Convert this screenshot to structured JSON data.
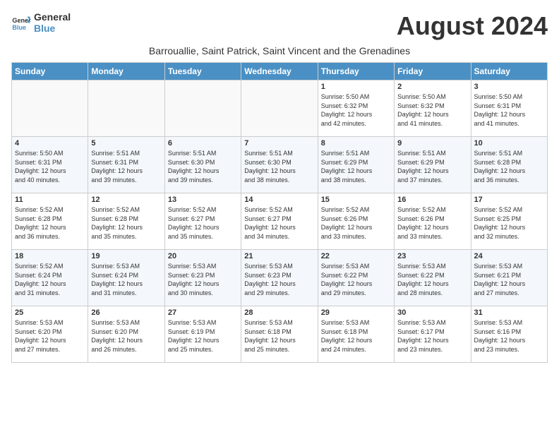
{
  "logo": {
    "line1": "General",
    "line2": "Blue"
  },
  "title": "August 2024",
  "subtitle": "Barrouallie, Saint Patrick, Saint Vincent and the Grenadines",
  "headers": [
    "Sunday",
    "Monday",
    "Tuesday",
    "Wednesday",
    "Thursday",
    "Friday",
    "Saturday"
  ],
  "weeks": [
    [
      {
        "day": "",
        "info": ""
      },
      {
        "day": "",
        "info": ""
      },
      {
        "day": "",
        "info": ""
      },
      {
        "day": "",
        "info": ""
      },
      {
        "day": "1",
        "info": "Sunrise: 5:50 AM\nSunset: 6:32 PM\nDaylight: 12 hours\nand 42 minutes."
      },
      {
        "day": "2",
        "info": "Sunrise: 5:50 AM\nSunset: 6:32 PM\nDaylight: 12 hours\nand 41 minutes."
      },
      {
        "day": "3",
        "info": "Sunrise: 5:50 AM\nSunset: 6:31 PM\nDaylight: 12 hours\nand 41 minutes."
      }
    ],
    [
      {
        "day": "4",
        "info": "Sunrise: 5:50 AM\nSunset: 6:31 PM\nDaylight: 12 hours\nand 40 minutes."
      },
      {
        "day": "5",
        "info": "Sunrise: 5:51 AM\nSunset: 6:31 PM\nDaylight: 12 hours\nand 39 minutes."
      },
      {
        "day": "6",
        "info": "Sunrise: 5:51 AM\nSunset: 6:30 PM\nDaylight: 12 hours\nand 39 minutes."
      },
      {
        "day": "7",
        "info": "Sunrise: 5:51 AM\nSunset: 6:30 PM\nDaylight: 12 hours\nand 38 minutes."
      },
      {
        "day": "8",
        "info": "Sunrise: 5:51 AM\nSunset: 6:29 PM\nDaylight: 12 hours\nand 38 minutes."
      },
      {
        "day": "9",
        "info": "Sunrise: 5:51 AM\nSunset: 6:29 PM\nDaylight: 12 hours\nand 37 minutes."
      },
      {
        "day": "10",
        "info": "Sunrise: 5:51 AM\nSunset: 6:28 PM\nDaylight: 12 hours\nand 36 minutes."
      }
    ],
    [
      {
        "day": "11",
        "info": "Sunrise: 5:52 AM\nSunset: 6:28 PM\nDaylight: 12 hours\nand 36 minutes."
      },
      {
        "day": "12",
        "info": "Sunrise: 5:52 AM\nSunset: 6:28 PM\nDaylight: 12 hours\nand 35 minutes."
      },
      {
        "day": "13",
        "info": "Sunrise: 5:52 AM\nSunset: 6:27 PM\nDaylight: 12 hours\nand 35 minutes."
      },
      {
        "day": "14",
        "info": "Sunrise: 5:52 AM\nSunset: 6:27 PM\nDaylight: 12 hours\nand 34 minutes."
      },
      {
        "day": "15",
        "info": "Sunrise: 5:52 AM\nSunset: 6:26 PM\nDaylight: 12 hours\nand 33 minutes."
      },
      {
        "day": "16",
        "info": "Sunrise: 5:52 AM\nSunset: 6:26 PM\nDaylight: 12 hours\nand 33 minutes."
      },
      {
        "day": "17",
        "info": "Sunrise: 5:52 AM\nSunset: 6:25 PM\nDaylight: 12 hours\nand 32 minutes."
      }
    ],
    [
      {
        "day": "18",
        "info": "Sunrise: 5:52 AM\nSunset: 6:24 PM\nDaylight: 12 hours\nand 31 minutes."
      },
      {
        "day": "19",
        "info": "Sunrise: 5:53 AM\nSunset: 6:24 PM\nDaylight: 12 hours\nand 31 minutes."
      },
      {
        "day": "20",
        "info": "Sunrise: 5:53 AM\nSunset: 6:23 PM\nDaylight: 12 hours\nand 30 minutes."
      },
      {
        "day": "21",
        "info": "Sunrise: 5:53 AM\nSunset: 6:23 PM\nDaylight: 12 hours\nand 29 minutes."
      },
      {
        "day": "22",
        "info": "Sunrise: 5:53 AM\nSunset: 6:22 PM\nDaylight: 12 hours\nand 29 minutes."
      },
      {
        "day": "23",
        "info": "Sunrise: 5:53 AM\nSunset: 6:22 PM\nDaylight: 12 hours\nand 28 minutes."
      },
      {
        "day": "24",
        "info": "Sunrise: 5:53 AM\nSunset: 6:21 PM\nDaylight: 12 hours\nand 27 minutes."
      }
    ],
    [
      {
        "day": "25",
        "info": "Sunrise: 5:53 AM\nSunset: 6:20 PM\nDaylight: 12 hours\nand 27 minutes."
      },
      {
        "day": "26",
        "info": "Sunrise: 5:53 AM\nSunset: 6:20 PM\nDaylight: 12 hours\nand 26 minutes."
      },
      {
        "day": "27",
        "info": "Sunrise: 5:53 AM\nSunset: 6:19 PM\nDaylight: 12 hours\nand 25 minutes."
      },
      {
        "day": "28",
        "info": "Sunrise: 5:53 AM\nSunset: 6:18 PM\nDaylight: 12 hours\nand 25 minutes."
      },
      {
        "day": "29",
        "info": "Sunrise: 5:53 AM\nSunset: 6:18 PM\nDaylight: 12 hours\nand 24 minutes."
      },
      {
        "day": "30",
        "info": "Sunrise: 5:53 AM\nSunset: 6:17 PM\nDaylight: 12 hours\nand 23 minutes."
      },
      {
        "day": "31",
        "info": "Sunrise: 5:53 AM\nSunset: 6:16 PM\nDaylight: 12 hours\nand 23 minutes."
      }
    ]
  ]
}
